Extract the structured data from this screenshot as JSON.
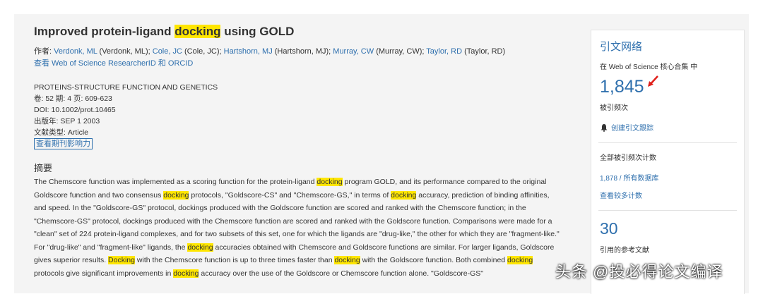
{
  "record": {
    "title_before": "Improved protein-ligand ",
    "title_highlight": "docking",
    "title_after": " using GOLD",
    "authors_label": "作者: ",
    "authors": [
      {
        "link": "Verdonk, ML",
        "full": " (Verdonk, ML); "
      },
      {
        "link": "Cole, JC",
        "full": " (Cole, JC); "
      },
      {
        "link": "Hartshorn, MJ",
        "full": " (Hartshorn, MJ); "
      },
      {
        "link": "Murray, CW",
        "full": " (Murray, CW); "
      },
      {
        "link": "Taylor, RD",
        "full": " (Taylor, RD)"
      }
    ],
    "researcher_id_link": "查看 Web of Science ResearcherID 和 ORCID",
    "journal": "PROTEINS-STRUCTURE FUNCTION AND GENETICS",
    "volume_line": "卷: 52  期: 4  页: 609-623",
    "doi_line": "DOI: 10.1002/prot.10465",
    "year_line": "出版年: SEP 1 2003",
    "doctype_line": "文献类型: Article",
    "impact_button": "查看期刊影响力",
    "abstract_heading": "摘要",
    "abstract_segments": [
      {
        "t": "The Chemscore function was implemented as a scoring function for the protein-ligand "
      },
      {
        "t": "docking",
        "hl": true
      },
      {
        "t": " program GOLD, and its performance compared to the original Goldscore function and two consensus "
      },
      {
        "t": "docking",
        "hl": true
      },
      {
        "t": " protocols, \"Goldscore-CS\" and \"Chemscore-GS,\" in terms of "
      },
      {
        "t": "docking",
        "hl": true
      },
      {
        "t": " accuracy, prediction of binding affinities, and speed. In the \"Goldscore-GS\" protocol, dockings produced with the Goldscore function are scored and ranked with the Chemscore function; in the \"Chemscore-GS\" protocol, dockings produced with the Chemscore function are scored and ranked with the Goldscore function. Comparisons were made for a \"clean\" set of 224 protein-ligand complexes, and for two subsets of this set, one for which the ligands are \"drug-like,\" the other for which they are \"fragment-like.\" For \"drug-like\" and \"fragment-like\" ligands, the "
      },
      {
        "t": "docking",
        "hl": true
      },
      {
        "t": " accuracies obtained with Chemscore and Goldscore functions are similar. For larger ligands, Goldscore gives superior results. "
      },
      {
        "t": "Docking",
        "hl": true
      },
      {
        "t": " with the Chemscore function is up to three times faster than "
      },
      {
        "t": "docking",
        "hl": true
      },
      {
        "t": " with the Goldscore function. Both combined "
      },
      {
        "t": "docking",
        "hl": true
      },
      {
        "t": " protocols give significant improvements in "
      },
      {
        "t": "docking",
        "hl": true
      },
      {
        "t": " accuracy over the use of the Goldscore or Chemscore function alone. \"Goldscore-GS\""
      }
    ]
  },
  "sidebar": {
    "title": "引文网络",
    "scope": "在 Web of Science 核心合集 中",
    "times_cited": "1,845",
    "times_cited_label": "被引频次",
    "create_alert": "创建引文跟踪",
    "all_counts_label": "全部被引频次计数",
    "all_db_link": "1,878 / 所有数据库",
    "more_counts_link": "查看较多计数",
    "references_count": "30",
    "references_label": "引用的参考文献"
  },
  "watermark": "头条 @投必得论文编译",
  "colors": {
    "link": "#2e6fad",
    "highlight": "#ffe600",
    "arrow": "#e0201b"
  }
}
